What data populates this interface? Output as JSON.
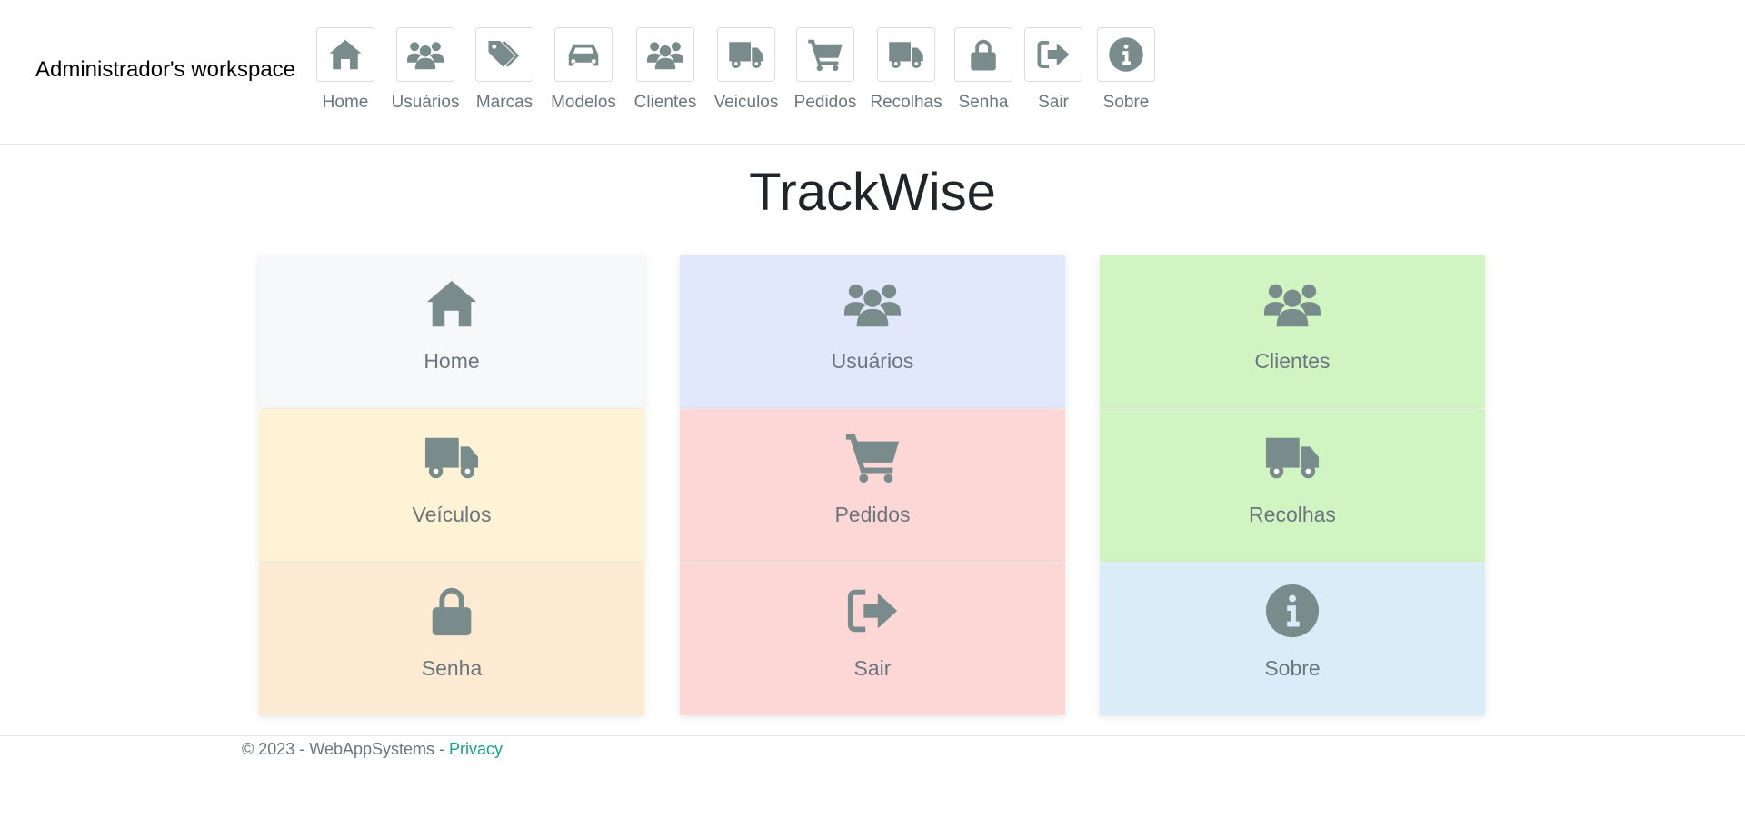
{
  "brand": "Administrador's workspace",
  "nav": [
    {
      "label": "Home",
      "icon": "home-icon"
    },
    {
      "label": "Usuários",
      "icon": "users-icon"
    },
    {
      "label": "Marcas",
      "icon": "tags-icon"
    },
    {
      "label": "Modelos",
      "icon": "car-icon"
    },
    {
      "label": "Clientes",
      "icon": "users-icon"
    },
    {
      "label": "Veiculos",
      "icon": "truck-icon"
    },
    {
      "label": "Pedidos",
      "icon": "cart-icon"
    },
    {
      "label": "Recolhas",
      "icon": "truck-icon"
    },
    {
      "label": "Senha",
      "icon": "lock-icon"
    },
    {
      "label": "Sair",
      "icon": "sign-out-icon"
    },
    {
      "label": "Sobre",
      "icon": "info-icon"
    }
  ],
  "main": {
    "title": "TrackWise"
  },
  "tiles": [
    {
      "label": "Home",
      "icon": "home-icon",
      "color": "#f7f8fa"
    },
    {
      "label": "Usuários",
      "icon": "users-icon",
      "color": "#e1e8fb"
    },
    {
      "label": "Clientes",
      "icon": "users-icon",
      "color": "#d0f5c3"
    },
    {
      "label": "Veículos",
      "icon": "truck-icon",
      "color": "#fff3d5"
    },
    {
      "label": "Pedidos",
      "icon": "cart-icon",
      "color": "#fdd6d6"
    },
    {
      "label": "Recolhas",
      "icon": "truck-icon",
      "color": "#d0f5c3"
    },
    {
      "label": "Senha",
      "icon": "lock-icon",
      "color": "#fdead3"
    },
    {
      "label": "Sair",
      "icon": "sign-out-icon",
      "color": "#fdd6d6"
    },
    {
      "label": "Sobre",
      "icon": "info-icon",
      "color": "#daecf8"
    }
  ],
  "footer": {
    "text": "© 2023 - WebAppSystems - ",
    "link": "Privacy"
  },
  "colors": {
    "icon": "#7a8b8b",
    "link": "#1b9e8a"
  }
}
